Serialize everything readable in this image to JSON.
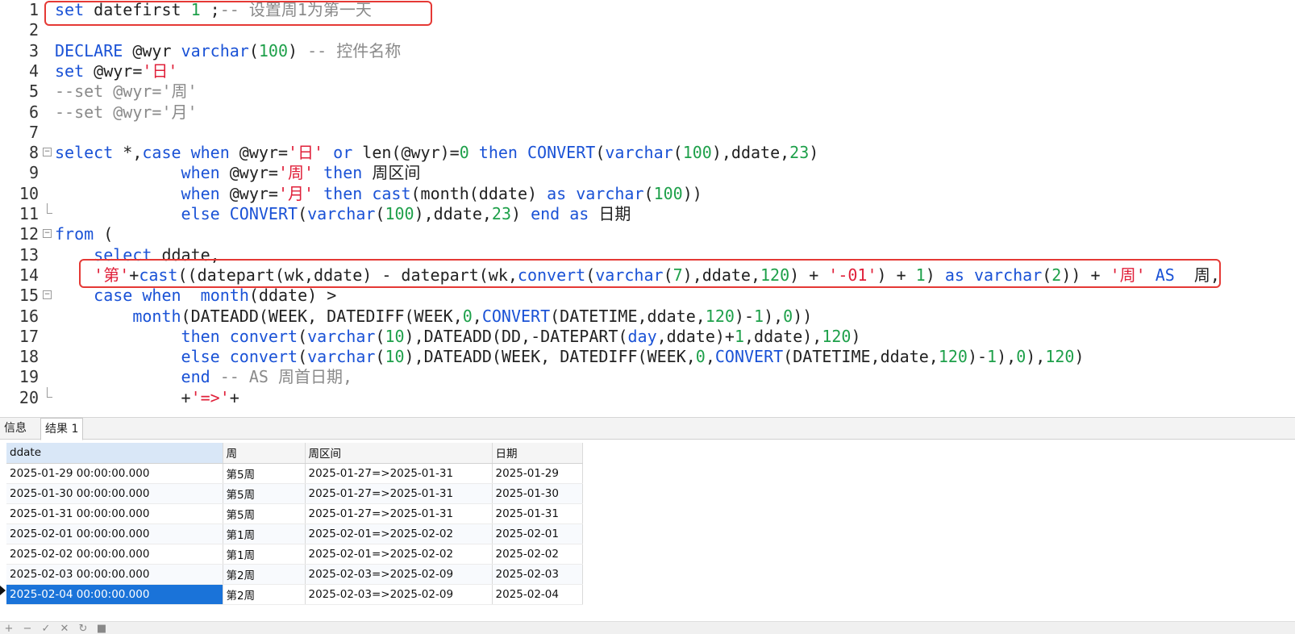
{
  "editor": {
    "lines": [
      {
        "n": "1",
        "tokens": [
          [
            "kw",
            "set"
          ],
          [
            "pl",
            " datefirst "
          ],
          [
            "num",
            "1"
          ],
          [
            "pl",
            " ;"
          ],
          [
            "cm",
            "-- 设置周1为第一天"
          ]
        ]
      },
      {
        "n": "2",
        "tokens": []
      },
      {
        "n": "3",
        "tokens": [
          [
            "kw",
            "DECLARE"
          ],
          [
            "pl",
            " @wyr "
          ],
          [
            "kw",
            "varchar"
          ],
          [
            "pl",
            "("
          ],
          [
            "num",
            "100"
          ],
          [
            "pl",
            ") "
          ],
          [
            "cm",
            "-- 控件名称"
          ]
        ]
      },
      {
        "n": "4",
        "tokens": [
          [
            "kw",
            "set"
          ],
          [
            "pl",
            " @wyr="
          ],
          [
            "str",
            "'日'"
          ]
        ]
      },
      {
        "n": "5",
        "tokens": [
          [
            "cm",
            "--set @wyr='周'"
          ]
        ]
      },
      {
        "n": "6",
        "tokens": [
          [
            "cm",
            "--set @wyr='月'"
          ]
        ]
      },
      {
        "n": "7",
        "tokens": []
      },
      {
        "n": "8",
        "tokens": [
          [
            "kw",
            "select"
          ],
          [
            "pl",
            " *,"
          ],
          [
            "kw",
            "case"
          ],
          [
            "pl",
            " "
          ],
          [
            "kw",
            "when"
          ],
          [
            "pl",
            " @wyr="
          ],
          [
            "str",
            "'日'"
          ],
          [
            "pl",
            " "
          ],
          [
            "kw",
            "or"
          ],
          [
            "pl",
            " len(@wyr)="
          ],
          [
            "num",
            "0"
          ],
          [
            "pl",
            " "
          ],
          [
            "kw",
            "then"
          ],
          [
            "pl",
            " "
          ],
          [
            "kw",
            "CONVERT"
          ],
          [
            "pl",
            "("
          ],
          [
            "kw",
            "varchar"
          ],
          [
            "pl",
            "("
          ],
          [
            "num",
            "100"
          ],
          [
            "pl",
            "),ddate,"
          ],
          [
            "num",
            "23"
          ],
          [
            "pl",
            ")"
          ]
        ]
      },
      {
        "n": "9",
        "tokens": [
          [
            "pl",
            "             "
          ],
          [
            "kw",
            "when"
          ],
          [
            "pl",
            " @wyr="
          ],
          [
            "str",
            "'周'"
          ],
          [
            "pl",
            " "
          ],
          [
            "kw",
            "then"
          ],
          [
            "pl",
            " 周区间"
          ]
        ]
      },
      {
        "n": "10",
        "tokens": [
          [
            "pl",
            "             "
          ],
          [
            "kw",
            "when"
          ],
          [
            "pl",
            " @wyr="
          ],
          [
            "str",
            "'月'"
          ],
          [
            "pl",
            " "
          ],
          [
            "kw",
            "then"
          ],
          [
            "pl",
            " "
          ],
          [
            "kw",
            "cast"
          ],
          [
            "pl",
            "(month(ddate) "
          ],
          [
            "kw",
            "as"
          ],
          [
            "pl",
            " "
          ],
          [
            "kw",
            "varchar"
          ],
          [
            "pl",
            "("
          ],
          [
            "num",
            "100"
          ],
          [
            "pl",
            "))"
          ]
        ]
      },
      {
        "n": "11",
        "tokens": [
          [
            "pl",
            "             "
          ],
          [
            "kw",
            "else"
          ],
          [
            "pl",
            " "
          ],
          [
            "kw",
            "CONVERT"
          ],
          [
            "pl",
            "("
          ],
          [
            "kw",
            "varchar"
          ],
          [
            "pl",
            "("
          ],
          [
            "num",
            "100"
          ],
          [
            "pl",
            "),ddate,"
          ],
          [
            "num",
            "23"
          ],
          [
            "pl",
            ") "
          ],
          [
            "kw",
            "end"
          ],
          [
            "pl",
            " "
          ],
          [
            "kw",
            "as"
          ],
          [
            "pl",
            " 日期"
          ]
        ]
      },
      {
        "n": "12",
        "tokens": [
          [
            "kw",
            "from"
          ],
          [
            "pl",
            " ("
          ]
        ]
      },
      {
        "n": "13",
        "tokens": [
          [
            "pl",
            "    "
          ],
          [
            "kw",
            "select"
          ],
          [
            "pl",
            " ddate,"
          ]
        ]
      },
      {
        "n": "14",
        "tokens": [
          [
            "pl",
            "    "
          ],
          [
            "str",
            "'第'"
          ],
          [
            "pl",
            "+"
          ],
          [
            "kw",
            "cast"
          ],
          [
            "pl",
            "((datepart(wk,ddate) - datepart(wk,"
          ],
          [
            "kw",
            "convert"
          ],
          [
            "pl",
            "("
          ],
          [
            "kw",
            "varchar"
          ],
          [
            "pl",
            "("
          ],
          [
            "num",
            "7"
          ],
          [
            "pl",
            "),ddate,"
          ],
          [
            "num",
            "120"
          ],
          [
            "pl",
            ") + "
          ],
          [
            "str",
            "'-01'"
          ],
          [
            "pl",
            ") + "
          ],
          [
            "num",
            "1"
          ],
          [
            "pl",
            ") "
          ],
          [
            "kw",
            "as"
          ],
          [
            "pl",
            " "
          ],
          [
            "kw",
            "varchar"
          ],
          [
            "pl",
            "("
          ],
          [
            "num",
            "2"
          ],
          [
            "pl",
            ")) + "
          ],
          [
            "str",
            "'周'"
          ],
          [
            "pl",
            " "
          ],
          [
            "kw",
            "AS"
          ],
          [
            "pl",
            "  周,"
          ]
        ]
      },
      {
        "n": "15",
        "tokens": [
          [
            "pl",
            "    "
          ],
          [
            "kw",
            "case"
          ],
          [
            "pl",
            " "
          ],
          [
            "kw",
            "when"
          ],
          [
            "pl",
            "  "
          ],
          [
            "kw",
            "month"
          ],
          [
            "pl",
            "(ddate) >"
          ]
        ]
      },
      {
        "n": "16",
        "tokens": [
          [
            "pl",
            "        "
          ],
          [
            "kw",
            "month"
          ],
          [
            "pl",
            "(DATEADD(WEEK, DATEDIFF(WEEK,"
          ],
          [
            "num",
            "0"
          ],
          [
            "pl",
            ","
          ],
          [
            "kw",
            "CONVERT"
          ],
          [
            "pl",
            "(DATETIME,ddate,"
          ],
          [
            "num",
            "120"
          ],
          [
            "pl",
            ")-"
          ],
          [
            "num",
            "1"
          ],
          [
            "pl",
            "),"
          ],
          [
            "num",
            "0"
          ],
          [
            "pl",
            "))"
          ]
        ]
      },
      {
        "n": "17",
        "tokens": [
          [
            "pl",
            "             "
          ],
          [
            "kw",
            "then"
          ],
          [
            "pl",
            " "
          ],
          [
            "kw",
            "convert"
          ],
          [
            "pl",
            "("
          ],
          [
            "kw",
            "varchar"
          ],
          [
            "pl",
            "("
          ],
          [
            "num",
            "10"
          ],
          [
            "pl",
            "),DATEADD(DD,-DATEPART("
          ],
          [
            "kw",
            "day"
          ],
          [
            "pl",
            ",ddate)+"
          ],
          [
            "num",
            "1"
          ],
          [
            "pl",
            ",ddate),"
          ],
          [
            "num",
            "120"
          ],
          [
            "pl",
            ")"
          ]
        ]
      },
      {
        "n": "18",
        "tokens": [
          [
            "pl",
            "             "
          ],
          [
            "kw",
            "else"
          ],
          [
            "pl",
            " "
          ],
          [
            "kw",
            "convert"
          ],
          [
            "pl",
            "("
          ],
          [
            "kw",
            "varchar"
          ],
          [
            "pl",
            "("
          ],
          [
            "num",
            "10"
          ],
          [
            "pl",
            "),DATEADD(WEEK, DATEDIFF(WEEK,"
          ],
          [
            "num",
            "0"
          ],
          [
            "pl",
            ","
          ],
          [
            "kw",
            "CONVERT"
          ],
          [
            "pl",
            "(DATETIME,ddate,"
          ],
          [
            "num",
            "120"
          ],
          [
            "pl",
            ")-"
          ],
          [
            "num",
            "1"
          ],
          [
            "pl",
            "),"
          ],
          [
            "num",
            "0"
          ],
          [
            "pl",
            "),"
          ],
          [
            "num",
            "120"
          ],
          [
            "pl",
            ")"
          ]
        ]
      },
      {
        "n": "19",
        "tokens": [
          [
            "pl",
            "             "
          ],
          [
            "kw",
            "end"
          ],
          [
            "pl",
            " "
          ],
          [
            "cm",
            "-- AS 周首日期,"
          ]
        ]
      },
      {
        "n": "20",
        "tokens": [
          [
            "pl",
            "             +"
          ],
          [
            "str",
            "'=>'"
          ],
          [
            "pl",
            "+"
          ]
        ]
      }
    ]
  },
  "colors": {
    "keyword": "#1a52d6",
    "number": "#1ea04a",
    "string": "#e0203a",
    "comment": "#8a8a8a",
    "highlight_box": "#e53935",
    "selection": "#1a73d9"
  },
  "results": {
    "tabs": [
      {
        "label": "信息",
        "active": false
      },
      {
        "label": "结果 1",
        "active": true
      }
    ],
    "columns": [
      "ddate",
      "周",
      "周区间",
      "日期"
    ],
    "rows": [
      [
        "2025-01-29 00:00:00.000",
        "第5周",
        "2025-01-27=>2025-01-31",
        "2025-01-29"
      ],
      [
        "2025-01-30 00:00:00.000",
        "第5周",
        "2025-01-27=>2025-01-31",
        "2025-01-30"
      ],
      [
        "2025-01-31 00:00:00.000",
        "第5周",
        "2025-01-27=>2025-01-31",
        "2025-01-31"
      ],
      [
        "2025-02-01 00:00:00.000",
        "第1周",
        "2025-02-01=>2025-02-02",
        "2025-02-01"
      ],
      [
        "2025-02-02 00:00:00.000",
        "第1周",
        "2025-02-01=>2025-02-02",
        "2025-02-02"
      ],
      [
        "2025-02-03 00:00:00.000",
        "第2周",
        "2025-02-03=>2025-02-09",
        "2025-02-03"
      ],
      [
        "2025-02-04 00:00:00.000",
        "第2周",
        "2025-02-03=>2025-02-09",
        "2025-02-04"
      ]
    ],
    "selected_row": 6,
    "statusbar": [
      {
        "icon": "add-record-icon",
        "glyph": "+"
      },
      {
        "icon": "delete-record-icon",
        "glyph": "−"
      },
      {
        "icon": "apply-changes-icon",
        "glyph": "✓"
      },
      {
        "icon": "discard-changes-icon",
        "glyph": "✕"
      },
      {
        "icon": "refresh-icon",
        "glyph": "↻"
      },
      {
        "icon": "stop-icon",
        "glyph": "■"
      }
    ]
  }
}
